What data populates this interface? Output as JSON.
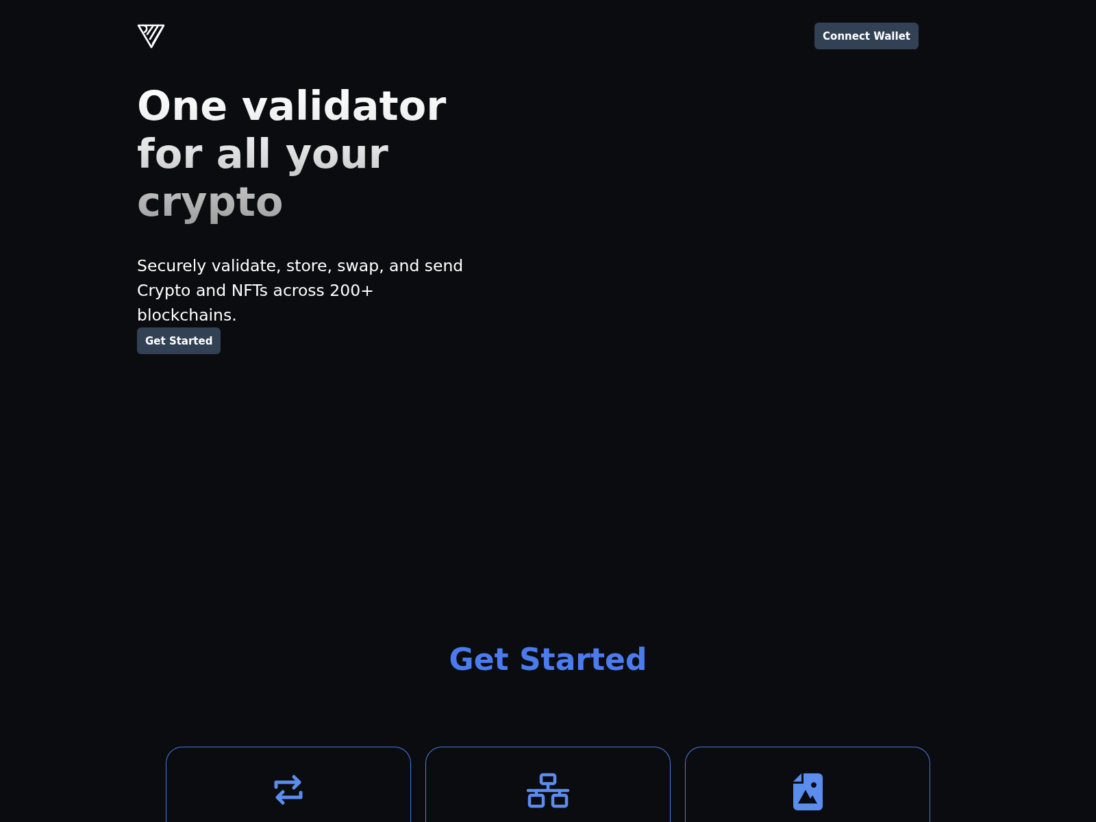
{
  "header": {
    "connect_button": "Connect Wallet"
  },
  "hero": {
    "headline": "One validator for all your crypto",
    "subtitle": "Securely validate, store, swap, and send Crypto and NFTs across 200+ blockchains.",
    "cta_button": "Get Started"
  },
  "get_started": {
    "heading": "Get Started",
    "cards": [
      {
        "kind": "swap"
      },
      {
        "kind": "network"
      },
      {
        "kind": "nft"
      }
    ]
  }
}
